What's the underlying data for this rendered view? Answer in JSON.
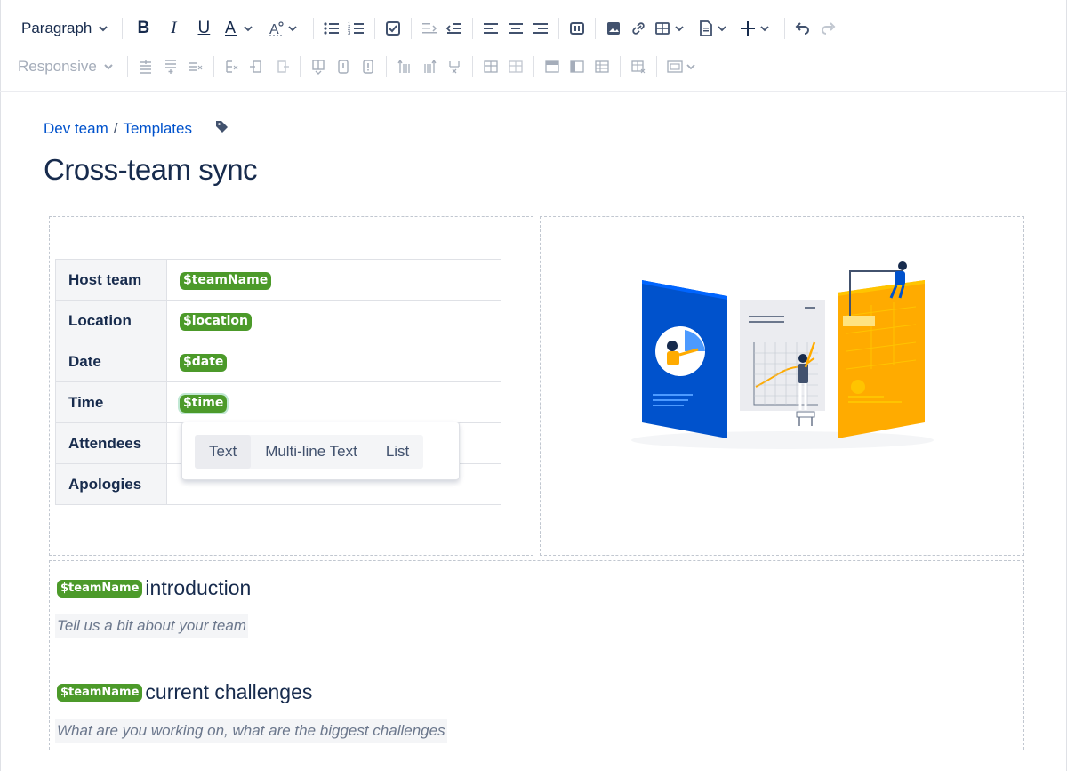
{
  "toolbar": {
    "paragraph_label": "Paragraph",
    "responsive_label": "Responsive"
  },
  "breadcrumb": {
    "space": "Dev team",
    "separator": "/",
    "page": "Templates"
  },
  "page": {
    "title": "Cross-team sync"
  },
  "info_table": {
    "rows": [
      {
        "label": "Host team",
        "variable": "$teamName"
      },
      {
        "label": "Location",
        "variable": "$location"
      },
      {
        "label": "Date",
        "variable": "$date"
      },
      {
        "label": "Time",
        "variable": "$time"
      },
      {
        "label": "Attendees",
        "variable": ""
      },
      {
        "label": "Apologies",
        "variable": ""
      }
    ]
  },
  "variable_popup": {
    "options": [
      "Text",
      "Multi-line Text",
      "List"
    ],
    "selected": "Text"
  },
  "sections": [
    {
      "variable": "$teamName",
      "heading": "introduction",
      "hint": "Tell us a bit about your team"
    },
    {
      "variable": "$teamName",
      "heading": "current challenges",
      "hint": "What are you working on, what are the biggest challenges"
    }
  ],
  "colors": {
    "variable_bg": "#4c9a2a",
    "link": "#0052cc",
    "text": "#172b4d"
  }
}
